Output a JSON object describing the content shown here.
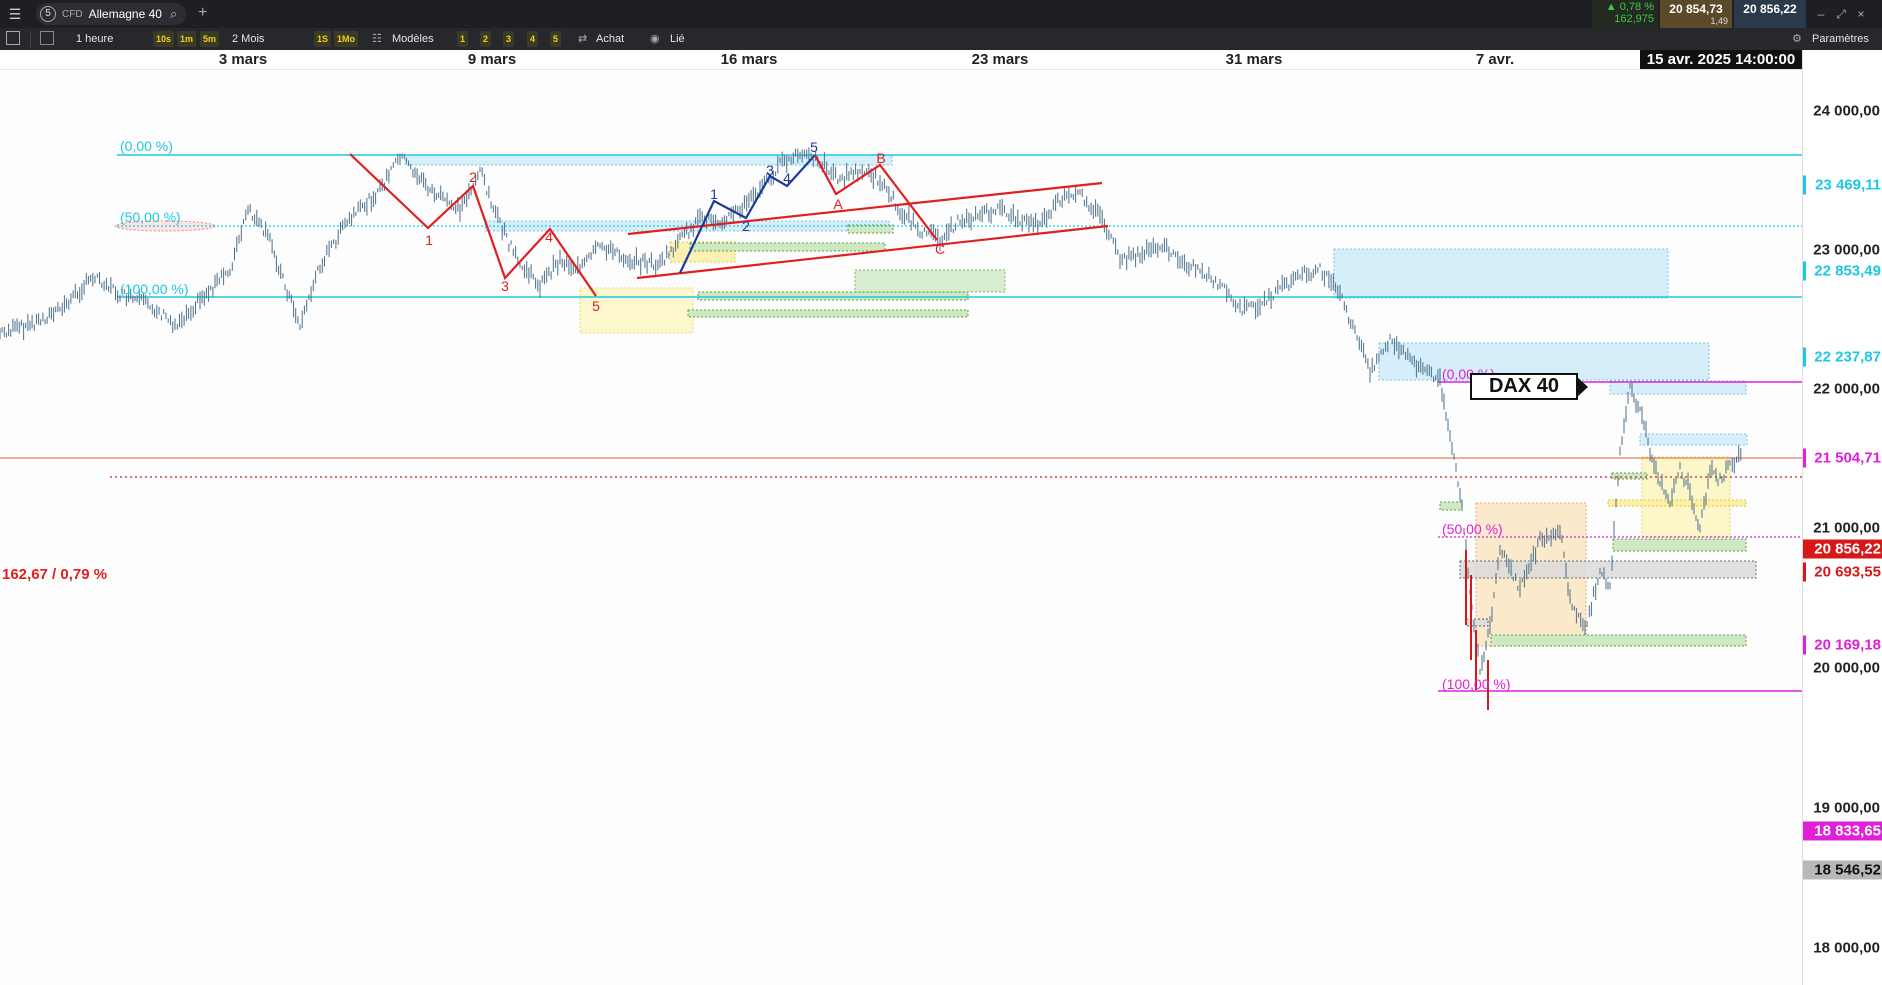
{
  "titlebar": {
    "tab_number": "5",
    "instrument_type": "CFD",
    "instrument_name": "Allemagne 40",
    "change_pct": "▲ 0,78 %",
    "change_pts": "162,975",
    "bid": "20 854,73",
    "spread": "1,49",
    "ask": "20 856,22",
    "menu_icon": "hamburger-icon",
    "search_icon": "search-icon",
    "add_tab_icon": "plus-icon"
  },
  "toolbar": {
    "period": "1 heure",
    "intervals": [
      "10s",
      "1m",
      "5m"
    ],
    "range": "2 Mois",
    "range_buttons": [
      "1S",
      "1Mo"
    ],
    "models_label": "Modèles",
    "model_slots": [
      "1",
      "2",
      "3",
      "4",
      "5"
    ],
    "buy_label": "Achat",
    "linked_label": "Lié",
    "settings_label": "Paramètres"
  },
  "date_axis": {
    "labels": [
      "3 mars",
      "9 mars",
      "16 mars",
      "23 mars",
      "31 mars",
      "7 avr."
    ],
    "cursor_date": "15 avr. 2025 14:00:00"
  },
  "price_axis": {
    "labels": [
      "24 000,00",
      "23 000,00",
      "22 000,00",
      "21 000,00",
      "20 000,00",
      "19 000,00",
      "18 000,00"
    ],
    "tags": [
      {
        "text": "23 469,11",
        "color": "#1ec8e0"
      },
      {
        "text": "22 853,49",
        "color": "#1ec8e0"
      },
      {
        "text": "22 237,87",
        "color": "#1ec8e0"
      },
      {
        "text": "21 504,71",
        "color": "#e020d8"
      },
      {
        "text": "20 856,22",
        "color": "#d81818"
      },
      {
        "text": "20 693,55",
        "color": "#d81818"
      },
      {
        "text": "20 169,18",
        "color": "#e020d8"
      },
      {
        "text": "18 833,65",
        "color": "#e020d8"
      },
      {
        "text": "18 546,52",
        "color": "#888888"
      }
    ]
  },
  "fib_levels": {
    "cyan": [
      "(0,00 %)",
      "(50,00 %)",
      "(100,00 %)"
    ],
    "magenta": [
      "(0,00 %)",
      "(50,00 %)",
      "(100,00 %)"
    ]
  },
  "wave_labels": {
    "red_impulse": [
      "1",
      "2",
      "3",
      "4",
      "5"
    ],
    "blue_impulse": [
      "1",
      "2",
      "3",
      "4",
      "5"
    ],
    "correction": [
      "A",
      "B",
      "C"
    ]
  },
  "annotations": {
    "spread_text": "162,67 / 0,79 %",
    "instrument_tag": "DAX 40"
  },
  "colors": {
    "fib_cyan": "#1ec8e0",
    "fib_magenta": "#e020d8",
    "price_red": "#d81818",
    "wave_red": "#e02020",
    "wave_blue": "#1a3c9a",
    "candles": "#4a6f8a"
  }
}
